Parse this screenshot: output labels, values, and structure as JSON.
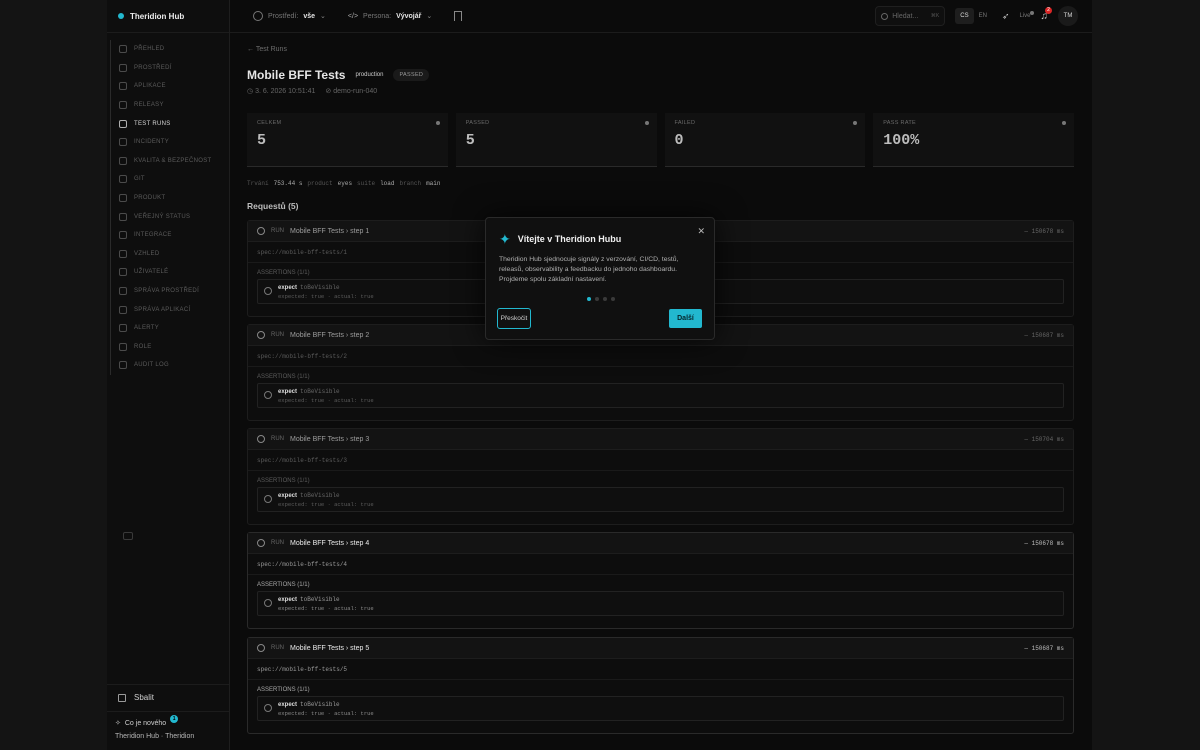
{
  "brand": "Theridion Hub",
  "sidebar": {
    "items": [
      {
        "label": "PŘEHLED",
        "active": false
      },
      {
        "label": "PROSTŘEDÍ",
        "active": false
      },
      {
        "label": "APLIKACE",
        "active": false
      },
      {
        "label": "RELEASY",
        "active": false
      },
      {
        "label": "TEST RUNS",
        "active": true
      },
      {
        "label": "INCIDENTY",
        "active": false
      },
      {
        "label": "KVALITA & BEZPEČNOST",
        "active": false
      },
      {
        "label": "GIT",
        "active": false
      },
      {
        "label": "PRODUKT",
        "active": false
      },
      {
        "label": "VEŘEJNÝ STATUS",
        "active": false
      },
      {
        "label": "INTEGRACE",
        "active": false
      },
      {
        "label": "VZHLED",
        "active": false
      },
      {
        "label": "UŽIVATELÉ",
        "active": false
      },
      {
        "label": "SPRÁVA PROSTŘEDÍ",
        "active": false
      },
      {
        "label": "SPRÁVA APLIKACÍ",
        "active": false
      },
      {
        "label": "ALERTY",
        "active": false
      },
      {
        "label": "ROLE",
        "active": false
      },
      {
        "label": "AUDIT LOG",
        "active": false
      }
    ],
    "collapse_label": "Sbalit",
    "whats_new_label": "Co je nového",
    "whats_new_count": "1",
    "footer": "Theridion Hub · Theridion"
  },
  "topbar": {
    "env_label": "Prostředí:",
    "env_value": "vše",
    "persona_label": "Persona:",
    "persona_value": "Vývojář",
    "search_placeholder": "Hledat...",
    "search_shortcut": "⌘K",
    "lang_cs": "CS",
    "lang_en": "EN",
    "live_label": "Live",
    "notif_count": "2",
    "avatar": "TM"
  },
  "page": {
    "back": "← Test Runs",
    "title": "Mobile BFF Tests",
    "env": "production",
    "status": "PASSED",
    "date": "3. 6. 2026 10:51:41",
    "run_id": "demo-run-040"
  },
  "stats": [
    {
      "label": "CELKEM",
      "value": "5"
    },
    {
      "label": "PASSED",
      "value": "5"
    },
    {
      "label": "FAILED",
      "value": "0"
    },
    {
      "label": "PASS RATE",
      "value": "100%"
    }
  ],
  "details": {
    "duration_key": "Trvání",
    "duration_val": "753.44 s",
    "product_key": "product",
    "product_val": "eyes",
    "suite_key": "suite",
    "suite_val": "load",
    "branch_key": "branch",
    "branch_val": "main"
  },
  "requests_heading": "Requestů (5)",
  "requests": [
    {
      "method": "RUN",
      "name": "Mobile BFF Tests › step 1",
      "duration": "— 150678 ms",
      "url": "spec://mobile-bff-tests/1",
      "assertions_label": "ASSERTIONS (1/1)",
      "expect": "expect",
      "matcher": "toBeVisible",
      "detail": "expected: true · actual: true"
    },
    {
      "method": "RUN",
      "name": "Mobile BFF Tests › step 2",
      "duration": "— 150687 ms",
      "url": "spec://mobile-bff-tests/2",
      "assertions_label": "ASSERTIONS (1/1)",
      "expect": "expect",
      "matcher": "toBeVisible",
      "detail": "expected: true · actual: true"
    },
    {
      "method": "RUN",
      "name": "Mobile BFF Tests › step 3",
      "duration": "— 150704 ms",
      "url": "spec://mobile-bff-tests/3",
      "assertions_label": "ASSERTIONS (1/1)",
      "expect": "expect",
      "matcher": "toBeVisible",
      "detail": "expected: true · actual: true"
    },
    {
      "method": "RUN",
      "name": "Mobile BFF Tests › step 4",
      "duration": "— 150678 ms",
      "url": "spec://mobile-bff-tests/4",
      "assertions_label": "ASSERTIONS (1/1)",
      "expect": "expect",
      "matcher": "toBeVisible",
      "detail": "expected: true · actual: true"
    },
    {
      "method": "RUN",
      "name": "Mobile BFF Tests › step 5",
      "duration": "— 150687 ms",
      "url": "spec://mobile-bff-tests/5",
      "assertions_label": "ASSERTIONS (1/1)",
      "expect": "expect",
      "matcher": "toBeVisible",
      "detail": "expected: true · actual: true"
    }
  ],
  "modal": {
    "title": "Vítejte v Theridion Hubu",
    "body": "Theridion Hub sjednocuje signály z verzování, CI/CD, testů, releasů, observability a feedbacku do jednoho dashboardu. Projdeme spolu základní nastavení.",
    "skip": "Přeskočit",
    "next": "Další",
    "steps_total": 4,
    "step_current": 1
  },
  "colors": {
    "accent": "#22b8cf",
    "danger": "#dc2626"
  }
}
